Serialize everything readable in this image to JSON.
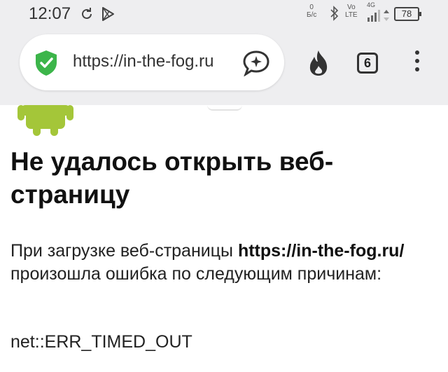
{
  "status_bar": {
    "time": "12:07",
    "net_speed_value": "0",
    "net_speed_unit": "Б/с",
    "carrier_top": "Vo",
    "carrier_bottom": "LTE",
    "network_type": "4G",
    "battery": "78"
  },
  "toolbar": {
    "url": "https://in-the-fog.ru",
    "tab_count": "6"
  },
  "page": {
    "heading": "Не удалось открыть веб-страницу",
    "desc_prefix": "При загрузке веб-страницы ",
    "desc_url": "https://in-the-fog.ru/",
    "desc_suffix": " произошла ошибка по следующим причинам:",
    "error_code": "net::ERR_TIMED_OUT"
  },
  "colors": {
    "android_green": "#a4c639",
    "shield_green": "#3cb54a",
    "chrome_bg": "#eeeef0"
  }
}
